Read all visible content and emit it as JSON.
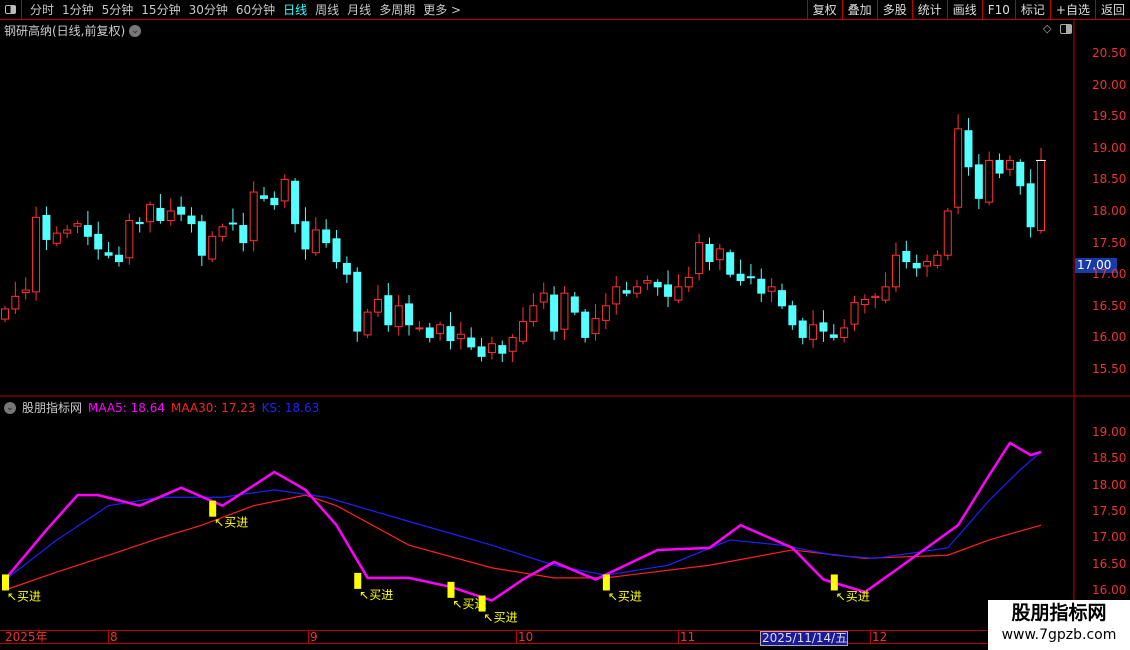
{
  "toolbar": {
    "periods": [
      "分时",
      "1分钟",
      "5分钟",
      "15分钟",
      "30分钟",
      "60分钟",
      "日线",
      "周线",
      "月线",
      "多周期",
      "更多 >"
    ],
    "active": "日线",
    "right_buttons": [
      "复权",
      "叠加",
      "多股",
      "统计",
      "画线",
      "F10",
      "标记",
      "+自选",
      "返回"
    ]
  },
  "stock_title": "钢研高纳(日线,前复权)",
  "current_price": "17.00",
  "price_axis": [
    "20.50",
    "20.00",
    "19.50",
    "19.00",
    "18.50",
    "18.00",
    "17.50",
    "17.00",
    "16.50",
    "16.00",
    "15.50"
  ],
  "indicator": {
    "name": "股朋指标网",
    "maa5_label": "MAA5: 18.64",
    "maa30_label": "MAA30: 17.23",
    "ks_label": "KS: 18.63",
    "axis": [
      "19.00",
      "18.50",
      "18.00",
      "17.50",
      "17.00",
      "16.50",
      "16.00"
    ],
    "signal_label": "买进"
  },
  "time_axis": [
    "2025年",
    "8",
    "9",
    "10",
    "11",
    "2025/11/14/五",
    "12"
  ],
  "watermark": {
    "name": "股朋指标网",
    "url": "www.7gpzb.com"
  },
  "colors": {
    "up": "#ff3232",
    "down": "#54ffff",
    "maa5": "#ff00ff",
    "maa30": "#ff2020",
    "ks": "#2020ff",
    "signal": "#ffff00"
  },
  "chart_data": {
    "type": "candlestick",
    "closes": [
      16.45,
      16.65,
      16.75,
      17.9,
      17.55,
      17.65,
      17.7,
      17.8,
      17.6,
      17.4,
      17.3,
      17.2,
      17.85,
      17.8,
      18.1,
      17.85,
      18.0,
      17.95,
      17.8,
      17.3,
      17.6,
      17.75,
      17.8,
      17.5,
      18.3,
      18.2,
      18.1,
      18.5,
      17.8,
      17.4,
      17.7,
      17.5,
      17.2,
      17.0,
      16.1,
      16.4,
      16.6,
      16.2,
      16.5,
      16.2,
      16.15,
      16.0,
      16.2,
      15.95,
      16.05,
      15.85,
      15.7,
      15.9,
      15.75,
      16.0,
      16.25,
      16.5,
      16.7,
      16.1,
      16.7,
      16.4,
      16.0,
      16.3,
      16.5,
      16.8,
      16.7,
      16.8,
      16.9,
      16.8,
      16.65,
      16.8,
      16.95,
      17.5,
      17.2,
      17.4,
      17.0,
      16.9,
      16.95,
      16.7,
      16.8,
      16.5,
      16.2,
      16.0,
      16.2,
      16.1,
      16.0,
      16.15,
      16.55,
      16.6,
      16.65,
      16.8,
      17.3,
      17.2,
      17.1,
      17.2,
      17.3,
      18.0,
      19.3,
      18.7,
      18.2,
      18.8,
      18.6,
      18.8,
      18.4,
      17.75,
      18.8
    ],
    "maa5": [
      [
        0,
        16.2
      ],
      [
        4,
        17.14
      ],
      [
        7,
        17.8
      ],
      [
        9,
        17.8
      ],
      [
        13,
        17.6
      ],
      [
        17,
        17.94
      ],
      [
        21,
        17.6
      ],
      [
        26,
        18.24
      ],
      [
        29,
        17.9
      ],
      [
        32,
        17.23
      ],
      [
        35,
        16.23
      ],
      [
        39,
        16.23
      ],
      [
        43,
        16.06
      ],
      [
        47,
        15.8
      ],
      [
        50,
        16.2
      ],
      [
        53,
        16.53
      ],
      [
        57,
        16.2
      ],
      [
        63,
        16.76
      ],
      [
        68,
        16.8
      ],
      [
        71,
        17.23
      ],
      [
        76,
        16.8
      ],
      [
        79,
        16.2
      ],
      [
        83,
        15.96
      ],
      [
        86,
        16.38
      ],
      [
        92,
        17.23
      ],
      [
        95,
        18.18
      ],
      [
        97,
        18.79
      ],
      [
        99,
        18.56
      ],
      [
        100,
        18.62
      ]
    ],
    "ks": [
      [
        0,
        16.19
      ],
      [
        5,
        16.95
      ],
      [
        10,
        17.6
      ],
      [
        15,
        17.76
      ],
      [
        21,
        17.76
      ],
      [
        26,
        17.9
      ],
      [
        31,
        17.76
      ],
      [
        39,
        17.3
      ],
      [
        47,
        16.85
      ],
      [
        53,
        16.47
      ],
      [
        58,
        16.28
      ],
      [
        64,
        16.47
      ],
      [
        70,
        16.95
      ],
      [
        75,
        16.85
      ],
      [
        80,
        16.66
      ],
      [
        84,
        16.6
      ],
      [
        91,
        16.8
      ],
      [
        95,
        17.7
      ],
      [
        98,
        18.28
      ],
      [
        100,
        18.62
      ]
    ],
    "maa30": [
      [
        0,
        16.0
      ],
      [
        5,
        16.34
      ],
      [
        10,
        16.66
      ],
      [
        15,
        16.99
      ],
      [
        19,
        17.23
      ],
      [
        24,
        17.6
      ],
      [
        29,
        17.8
      ],
      [
        32,
        17.6
      ],
      [
        39,
        16.85
      ],
      [
        47,
        16.42
      ],
      [
        53,
        16.23
      ],
      [
        58,
        16.23
      ],
      [
        68,
        16.47
      ],
      [
        76,
        16.76
      ],
      [
        83,
        16.6
      ],
      [
        91,
        16.66
      ],
      [
        95,
        16.95
      ],
      [
        100,
        17.23
      ]
    ],
    "signals": [
      0,
      20,
      34,
      43,
      46,
      58,
      80
    ]
  }
}
